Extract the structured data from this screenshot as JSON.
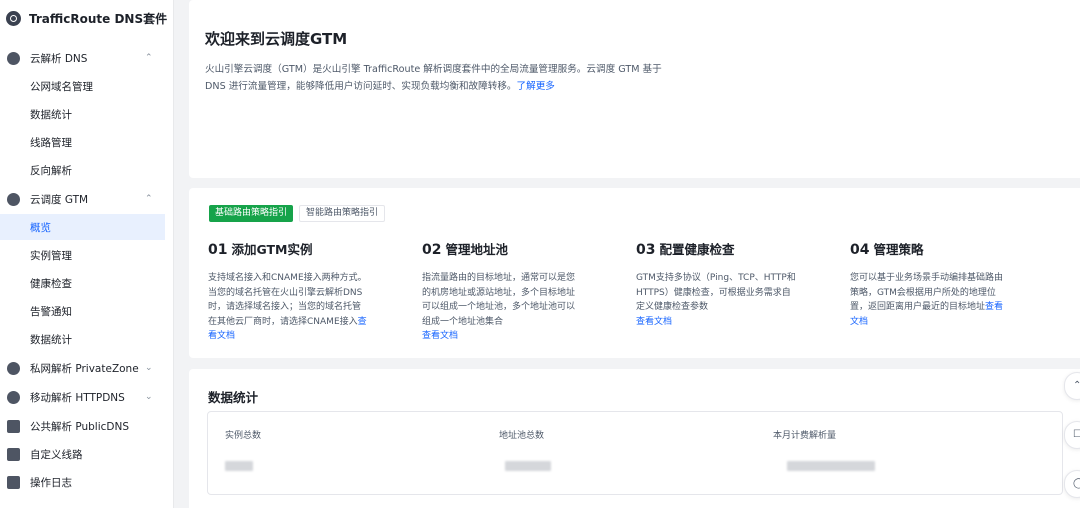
{
  "brand": {
    "name": "TrafficRoute DNS套件"
  },
  "sidebar": {
    "groups": [
      {
        "label": "云解析 DNS",
        "caret": "⌃",
        "children": [
          "公网域名管理",
          "数据统计",
          "线路管理",
          "反向解析"
        ]
      },
      {
        "label": "云调度 GTM",
        "caret": "⌃",
        "children": [
          "概览",
          "实例管理",
          "健康检查",
          "告警通知",
          "数据统计"
        ]
      },
      {
        "label": "私网解析 PrivateZone",
        "caret": "⌄"
      },
      {
        "label": "移动解析 HTTPDNS",
        "caret": "⌄"
      },
      {
        "label": "公共解析 PublicDNS"
      },
      {
        "label": "自定义线路"
      },
      {
        "label": "操作日志"
      }
    ]
  },
  "welcome": {
    "title": "欢迎来到云调度GTM",
    "desc": "火山引擎云调度（GTM）是火山引擎 TrafficRoute 解析调度套件中的全局流量管理服务。云调度 GTM 基于 DNS 进行流量管理，能够降低用户访问延时、实现负载均衡和故障转移。",
    "link": "了解更多"
  },
  "guide": {
    "tabs": [
      "基础路由策略指引",
      "智能路由策略指引"
    ],
    "steps": [
      {
        "num": "01",
        "title": "添加GTM实例",
        "desc": "支持域名接入和CNAME接入两种方式。当您的域名托管在火山引擎云解析DNS时，请选择域名接入；当您的域名托管在其他云厂商时，请选择CNAME接入",
        "link": "查看文档"
      },
      {
        "num": "02",
        "title": "管理地址池",
        "desc": "指流量路由的目标地址，通常可以是您的机房地址或源站地址，多个目标地址可以组成一个地址池，多个地址池可以组成一个地址池集合",
        "link": "查看文档"
      },
      {
        "num": "03",
        "title": "配置健康检查",
        "desc": "GTM支持多协议（Ping、TCP、HTTP和HTTPS）健康检查，可根据业务需求自定义健康检查参数",
        "link": "查看文档"
      },
      {
        "num": "04",
        "title": "管理策略",
        "desc": "您可以基于业务场景手动编排基础路由策略，GTM会根据用户所处的地理位置，返回距离用户最近的目标地址",
        "link": "查看文档"
      }
    ]
  },
  "stats": {
    "title": "数据统计",
    "items": [
      {
        "label": "实例总数"
      },
      {
        "label": "地址池总数"
      },
      {
        "label": "本月计费解析量"
      }
    ]
  },
  "floating": [
    "⌃",
    "☐",
    "◯"
  ]
}
